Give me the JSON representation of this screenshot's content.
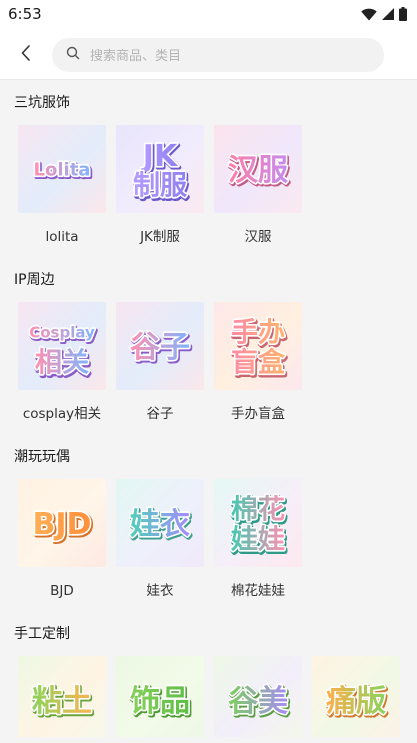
{
  "status": {
    "time": "6:53"
  },
  "search": {
    "placeholder": "搜索商品、类目"
  },
  "sections": [
    {
      "title": "三坑服饰",
      "items": [
        {
          "label": "lolita",
          "art": [
            "Lolita"
          ],
          "theme": "pink-blue"
        },
        {
          "label": "JK制服",
          "art": [
            "JK",
            "制服"
          ],
          "theme": "purple"
        },
        {
          "label": "汉服",
          "art": [
            "汉服"
          ],
          "theme": "pink-purple"
        }
      ]
    },
    {
      "title": "IP周边",
      "items": [
        {
          "label": "cosplay相关",
          "art": [
            "Cosplay",
            "相关"
          ],
          "theme": "pink-blue"
        },
        {
          "label": "谷子",
          "art": [
            "谷子"
          ],
          "theme": "pink-blue"
        },
        {
          "label": "手办盲盒",
          "art": [
            "手办",
            "盲盒"
          ],
          "theme": "pink-orange"
        }
      ]
    },
    {
      "title": "潮玩玩偶",
      "items": [
        {
          "label": "BJD",
          "art": [
            "BJD"
          ],
          "theme": "orange"
        },
        {
          "label": "娃衣",
          "art": [
            "娃衣"
          ],
          "theme": "teal-purple"
        },
        {
          "label": "棉花娃娃",
          "art": [
            "棉花",
            "娃娃"
          ],
          "theme": "teal-pink"
        }
      ]
    },
    {
      "title": "手工定制",
      "items": [
        {
          "label": "",
          "art": [
            "粘土"
          ],
          "theme": "green-orange"
        },
        {
          "label": "",
          "art": [
            "饰品"
          ],
          "theme": "green"
        },
        {
          "label": "",
          "art": [
            "谷美"
          ],
          "theme": "green-purple"
        },
        {
          "label": "",
          "art": [
            "痛版"
          ],
          "theme": "orange-green"
        }
      ]
    }
  ],
  "icons": {
    "back": "chevron-left-icon",
    "search": "search-icon",
    "wifi": "wifi-icon",
    "signal": "signal-icon",
    "battery": "battery-icon"
  },
  "colors": {
    "background": "#f4f4f4",
    "bar": "#ffffff",
    "text": "#1c1c1c",
    "placeholder": "#b3b3b3"
  }
}
